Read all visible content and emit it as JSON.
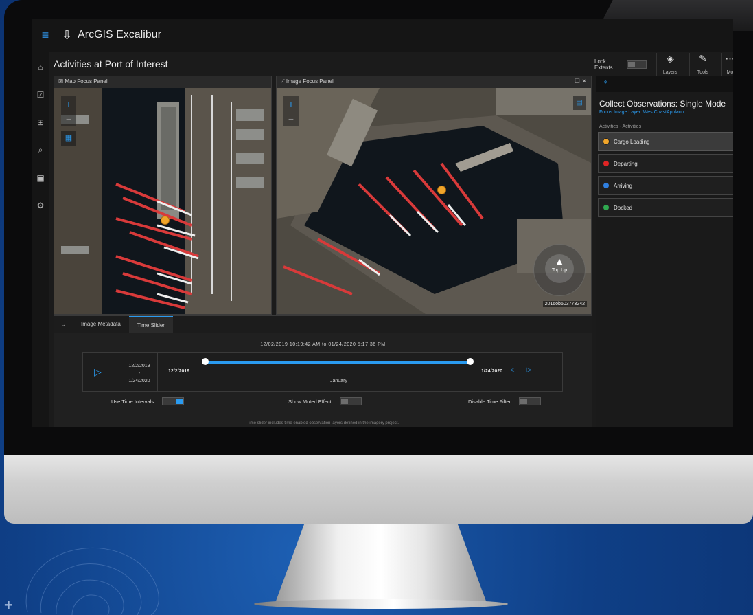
{
  "app": {
    "name": "ArcGIS Excalibur",
    "workspace_title": "Activities at Port of Interest"
  },
  "toolbar": {
    "lock_extents_label": "Lock Extents",
    "layers_label": "Layers",
    "tools_label": "Tools",
    "more_label": "Mo"
  },
  "map_panel": {
    "title": "Map Focus Panel"
  },
  "image_panel": {
    "title": "Image Focus Panel",
    "compass_label": "Top Up",
    "image_id": "2016ob503773242"
  },
  "observations": {
    "title": "Collect Observations: Single Mode",
    "subtitle": "Focus Image Layer: WestCoastApplanix",
    "group_label": "Activities - Activities",
    "items": [
      {
        "label": "Cargo Loading",
        "color": "#f0a52a",
        "selected": true
      },
      {
        "label": "Departing",
        "color": "#e02424",
        "selected": false
      },
      {
        "label": "Arriving",
        "color": "#2f7fe0",
        "selected": false
      },
      {
        "label": "Docked",
        "color": "#2fa84f",
        "selected": false
      }
    ]
  },
  "dock": {
    "tabs": [
      "Image Metadata",
      "Time Slider"
    ],
    "active_tab": "Time Slider",
    "range_text": "12/02/2019 10:19:42 AM to 01/24/2020 5:17:36 PM",
    "range_start_short": "12/2/2019",
    "range_dash": "-",
    "range_end_short": "1/24/2020",
    "slider_start": "12/2/2019",
    "slider_end": "1/24/2020",
    "month_label": "January",
    "options": {
      "use_time_intervals": "Use Time Intervals",
      "use_time_intervals_on": true,
      "show_muted_effect": "Show Muted Effect",
      "show_muted_effect_on": false,
      "disable_time_filter": "Disable Time Filter",
      "disable_time_filter_on": false
    },
    "footnote": "Time slider includes time enabled observation layers defined in the imagery project."
  },
  "colors": {
    "accent": "#2a9bf0"
  }
}
